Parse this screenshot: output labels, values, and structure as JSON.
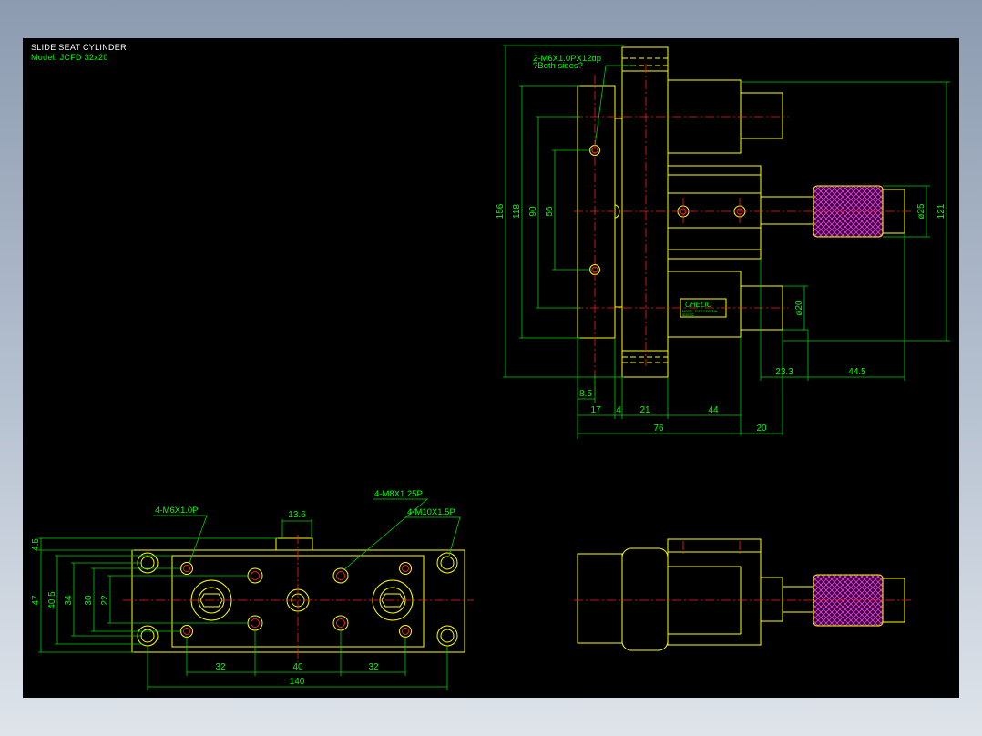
{
  "title_block": {
    "title": "SLIDE SEAT CYLINDER",
    "model": "Model:  JCFD 32x20"
  },
  "callouts": {
    "side_thread": "2-M6X1.0PX12dp",
    "side_note": "?Both sides?",
    "m6": "4-M6X1.0P",
    "m8": "4-M8X1.25P",
    "m10": "4-M10X1.5P"
  },
  "side_dims": {
    "d156": "156",
    "d118": "118",
    "d90": "90",
    "d56": "56",
    "d121": "121",
    "d25": "ø25",
    "d20": "ø20",
    "d23_3": "23.3",
    "d44_5": "44.5",
    "d8_5": "8.5",
    "d17": "17",
    "d4": "4",
    "d21": "21",
    "d44": "44",
    "d76": "76",
    "d20b": "20"
  },
  "front_dims": {
    "d4_5": "4.5",
    "d47": "47",
    "d40_5": "40.5",
    "d34": "34",
    "d30": "30",
    "d22": "22",
    "d13_6": "13.6",
    "d32a": "32",
    "d40": "40",
    "d32b": "32",
    "d140": "140"
  },
  "nameplate": {
    "brand": "CHELIC",
    "line1": "MODEL  JCFD  CERTAIN",
    "line2": "SIZE 32"
  },
  "colors": {
    "background": "#000000",
    "outline": "#ffff00",
    "dimension": "#00ff00",
    "centerline": "#ff1e1e",
    "knob": "#b000b0"
  }
}
